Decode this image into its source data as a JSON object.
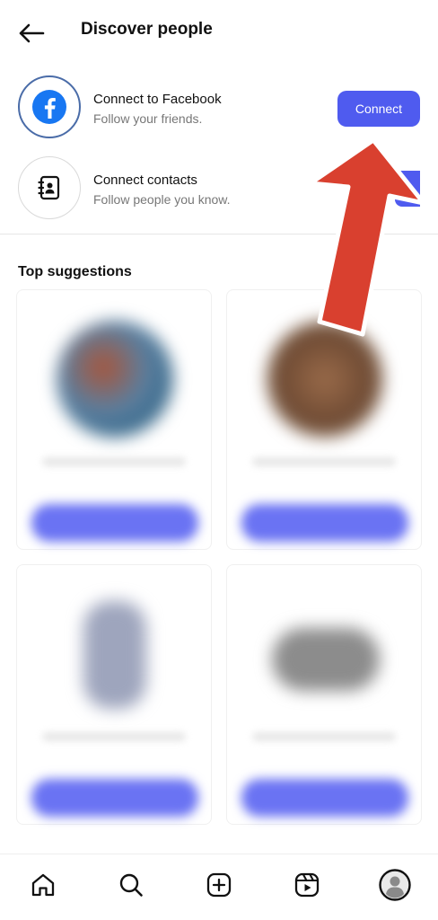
{
  "header": {
    "title": "Discover people",
    "back_icon": "arrow-left-icon"
  },
  "connect_facebook": {
    "title": "Connect to Facebook",
    "subtitle": "Follow your friends.",
    "button_label": "Connect",
    "icon": "facebook-icon",
    "brand_color": "#1877F2"
  },
  "connect_contacts": {
    "title": "Connect contacts",
    "subtitle": "Follow people you know.",
    "icon": "contacts-book-icon"
  },
  "suggestions": {
    "title": "Top suggestions"
  },
  "bottom_nav": {
    "items": [
      "home-icon",
      "search-icon",
      "create-icon",
      "reels-icon",
      "profile-icon"
    ]
  },
  "colors": {
    "accent": "#4F5BEF",
    "annotation_arrow": "#D9402F"
  }
}
